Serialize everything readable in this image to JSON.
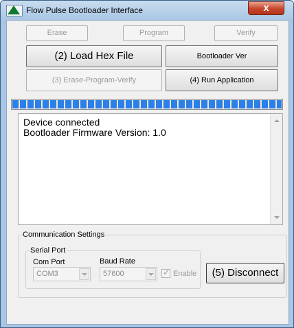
{
  "window": {
    "title": "Flow Pulse Bootloader Interface",
    "close_glyph": "x",
    "app_icon": "triangle-logo-icon"
  },
  "toolbar": {
    "erase": "Erase",
    "program": "Program",
    "verify": "Verify",
    "load_hex": "(2) Load Hex File",
    "bootloader_ver": "Bootloader Ver",
    "erase_program_verify": "(3) Erase-Program-Verify",
    "run_application": "(4) Run Application"
  },
  "progress": {
    "fraction": 1.0,
    "color": "#2b7fe6"
  },
  "log": {
    "lines": [
      "Device connected",
      "Bootloader Firmware Version: 1.0"
    ]
  },
  "comm": {
    "group_label": "Communication Settings",
    "serial_group_label": "Serial Port",
    "com_port_label": "Com Port",
    "com_port_value": "COM3",
    "baud_rate_label": "Baud Rate",
    "baud_rate_value": "57600",
    "enable_label": "Enable",
    "enable_checked": true,
    "disconnect": "(5) Disconnect"
  }
}
